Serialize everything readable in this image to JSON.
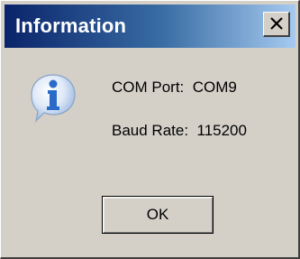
{
  "window": {
    "title": "Information",
    "close_icon": "close-icon"
  },
  "message": {
    "icon": "info-icon",
    "lines": [
      "COM Port:  COM9",
      "Baud Rate:  115200"
    ]
  },
  "buttons": {
    "ok_label": "OK"
  },
  "colors": {
    "title_bar_start": "#0a246a",
    "title_bar_end": "#a6caf0",
    "dialog_face": "#d4d0c8",
    "icon_blue": "#3f7fd0"
  }
}
